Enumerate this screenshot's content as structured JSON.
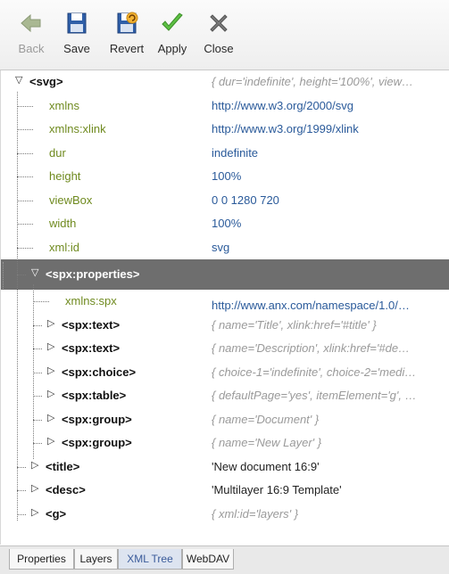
{
  "toolbar": {
    "back": "Back",
    "save": "Save",
    "revert": "Revert",
    "apply": "Apply",
    "close": "Close"
  },
  "tree": [
    {
      "depth": 0,
      "toggle": "▽",
      "kind": "el",
      "name": "<svg>",
      "value": "{ dur='indefinite', height='100%', view…",
      "vkind": "gray"
    },
    {
      "depth": 1,
      "kind": "attr",
      "name": "xmlns",
      "value": "http://www.w3.org/2000/svg",
      "vkind": "attr"
    },
    {
      "depth": 1,
      "kind": "attr",
      "name": "xmlns:xlink",
      "value": "http://www.w3.org/1999/xlink",
      "vkind": "attr"
    },
    {
      "depth": 1,
      "kind": "attr",
      "name": "dur",
      "value": "indefinite",
      "vkind": "attr"
    },
    {
      "depth": 1,
      "kind": "attr",
      "name": "height",
      "value": "100%",
      "vkind": "attr"
    },
    {
      "depth": 1,
      "kind": "attr",
      "name": "viewBox",
      "value": "0 0 1280 720",
      "vkind": "attr"
    },
    {
      "depth": 1,
      "kind": "attr",
      "name": "width",
      "value": "100%",
      "vkind": "attr"
    },
    {
      "depth": 1,
      "kind": "attr",
      "name": "xml:id",
      "value": "svg",
      "vkind": "attr"
    },
    {
      "depth": 1,
      "toggle": "▽",
      "kind": "el",
      "name": "<spx:properties>",
      "value": "",
      "vkind": "gray",
      "selected": true
    },
    {
      "depth": 2,
      "kind": "attr",
      "name": "xmlns:spx",
      "value": "http://www.anx.com/namespace/1.0/…",
      "vkind": "attr"
    },
    {
      "depth": 2,
      "toggle": "▷",
      "kind": "el",
      "name": "<spx:text>",
      "value": "{ name='Title', xlink:href='#title' }",
      "vkind": "gray"
    },
    {
      "depth": 2,
      "toggle": "▷",
      "kind": "el",
      "name": "<spx:text>",
      "value": "{ name='Description', xlink:href='#de…",
      "vkind": "gray"
    },
    {
      "depth": 2,
      "toggle": "▷",
      "kind": "el",
      "name": "<spx:choice>",
      "value": "{ choice-1='indefinite', choice-2='medi…",
      "vkind": "gray"
    },
    {
      "depth": 2,
      "toggle": "▷",
      "kind": "el",
      "name": "<spx:table>",
      "value": "{ defaultPage='yes', itemElement='g', …",
      "vkind": "gray"
    },
    {
      "depth": 2,
      "toggle": "▷",
      "kind": "el",
      "name": "<spx:group>",
      "value": "{ name='Document' }",
      "vkind": "gray"
    },
    {
      "depth": 2,
      "toggle": "▷",
      "kind": "el",
      "name": "<spx:group>",
      "value": "{ name='New Layer' }",
      "vkind": "gray"
    },
    {
      "depth": 1,
      "toggle": "▷",
      "kind": "el",
      "name": "<title>",
      "value": "'New document 16:9'",
      "vkind": "dark"
    },
    {
      "depth": 1,
      "toggle": "▷",
      "kind": "el",
      "name": "<desc>",
      "value": "'Multilayer 16:9 Template'",
      "vkind": "dark"
    },
    {
      "depth": 1,
      "toggle": "▷",
      "kind": "el",
      "name": "<g>",
      "value": "{ xml:id='layers' }",
      "vkind": "gray"
    }
  ],
  "tabs": [
    "Properties",
    "Layers",
    "XML Tree",
    "WebDAV"
  ],
  "active_tab": "XML Tree"
}
